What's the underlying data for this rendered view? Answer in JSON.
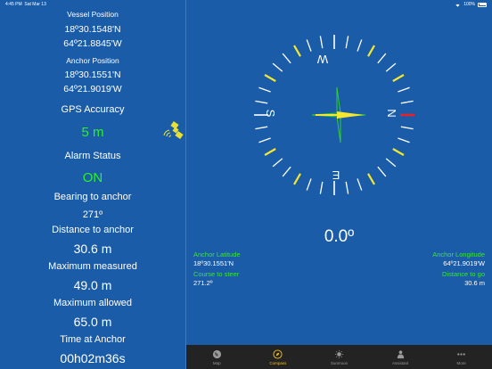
{
  "statusbar": {
    "time": "4:45 PM",
    "date": "Sat Mar 13",
    "battery": "100%"
  },
  "left": {
    "vessel_label": "Vessel Position",
    "vessel_lat": "18º30.1548'N",
    "vessel_lon": "64º21.8845'W",
    "anchor_label": "Anchor Position",
    "anchor_lat": "18º30.1551'N",
    "anchor_lon": "64º21.9019'W",
    "gps_label": "GPS Accuracy",
    "gps_value": "5 m",
    "alarm_label": "Alarm Status",
    "alarm_value": "ON",
    "bearing_label": "Bearing to anchor",
    "bearing_value": "271º",
    "distance_label": "Distance to anchor",
    "distance_value": "30.6 m",
    "maxmeasured_label": "Maximum measured",
    "maxmeasured_value": "49.0 m",
    "maxallowed_label": "Maximum allowed",
    "maxallowed_value": "65.0 m",
    "time_label": "Time at Anchor",
    "time_value": "00h02m36s"
  },
  "compass": {
    "heading": "0.0º",
    "cardinals": {
      "n": "N",
      "s": "S",
      "e": "E",
      "w": "W"
    },
    "colors": {
      "accent": "#f5e630",
      "north": "#e8202a",
      "needle": "#30d030"
    }
  },
  "info": {
    "anchor_lat_label": "Anchor Latitude",
    "anchor_lat_value": "18º30.1551'N",
    "anchor_lon_label": "Anchor Longitude",
    "anchor_lon_value": "64º21.9019'W",
    "course_label": "Course to steer",
    "course_value": "271.2º",
    "dist_label": "Distance to go",
    "dist_value": "30.6 m"
  },
  "tabs": [
    {
      "label": "Map",
      "icon": "globe-icon"
    },
    {
      "label": "Compass",
      "icon": "compass-icon"
    },
    {
      "label": "Sunmoon",
      "icon": "sun-moon-icon"
    },
    {
      "label": "Assistant",
      "icon": "assistant-icon"
    },
    {
      "label": "More",
      "icon": "more-icon"
    }
  ]
}
